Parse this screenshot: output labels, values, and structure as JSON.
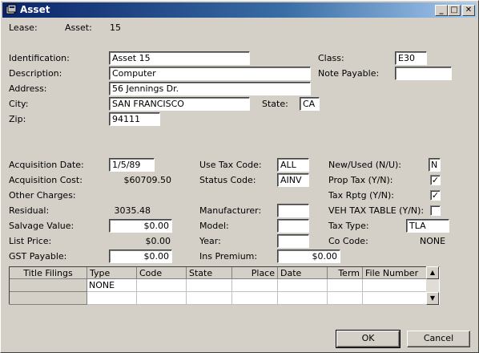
{
  "window": {
    "title": "Asset",
    "minimize": "_",
    "maximize": "□",
    "close": "✕"
  },
  "header": {
    "lease_label": "Lease:",
    "asset_label": "Asset:",
    "asset_value": "15"
  },
  "identification": {
    "identification_label": "Identification:",
    "identification_value": "Asset 15",
    "description_label": "Description:",
    "description_value": "Computer",
    "address_label": "Address:",
    "address_value": "56 Jennings Dr.",
    "city_label": "City:",
    "city_value": "SAN FRANCISCO",
    "state_label": "State:",
    "state_value": "CA",
    "zip_label": "Zip:",
    "zip_value": "94111",
    "class_label": "Class:",
    "class_value": "E30",
    "note_payable_label": "Note Payable:",
    "note_payable_value": ""
  },
  "financial": {
    "acquisition_date_label": "Acquisition Date:",
    "acquisition_date_value": "1/5/89",
    "acquisition_cost_label": "Acquisition Cost:",
    "acquisition_cost_value": "$60709.50",
    "other_charges_label": "Other Charges:",
    "residual_label": "Residual:",
    "residual_value": "3035.48",
    "salvage_value_label": "Salvage Value:",
    "salvage_value_value": "$0.00",
    "list_price_label": "List Price:",
    "list_price_value": "$0.00",
    "gst_payable_label": "GST Payable:",
    "gst_payable_value": "$0.00"
  },
  "middle": {
    "use_tax_code_label": "Use Tax Code:",
    "use_tax_code_value": "ALL",
    "status_code_label": "Status Code:",
    "status_code_value": "AINV",
    "manufacturer_label": "Manufacturer:",
    "manufacturer_value": "",
    "model_label": "Model:",
    "model_value": "",
    "year_label": "Year:",
    "year_value": "",
    "ins_premium_label": "Ins Premium:",
    "ins_premium_value": "$0.00"
  },
  "right": {
    "new_used_label": "New/Used (N/U):",
    "new_used_value": "N",
    "prop_tax_label": "Prop Tax (Y/N):",
    "prop_tax_checked": "✓",
    "tax_rptg_label": "Tax Rptg (Y/N):",
    "tax_rptg_checked": "✓",
    "veh_tax_table_label": "VEH TAX TABLE (Y/N):",
    "veh_tax_table_checked": "",
    "tax_type_label": "Tax Type:",
    "tax_type_value": "TLA",
    "co_code_label": "Co Code:",
    "co_code_value": "NONE"
  },
  "title_filings": {
    "title": "Title Filings",
    "columns": [
      "Type",
      "Code",
      "State",
      "Place",
      "Date",
      "Term",
      "File Number"
    ],
    "rows": [
      [
        "NONE",
        "",
        "",
        "",
        "",
        "",
        ""
      ],
      [
        "",
        "",
        "",
        "",
        "",
        "",
        ""
      ]
    ],
    "scroll_up": "▲",
    "scroll_down": "▼"
  },
  "buttons": {
    "ok": "OK",
    "cancel": "Cancel"
  }
}
